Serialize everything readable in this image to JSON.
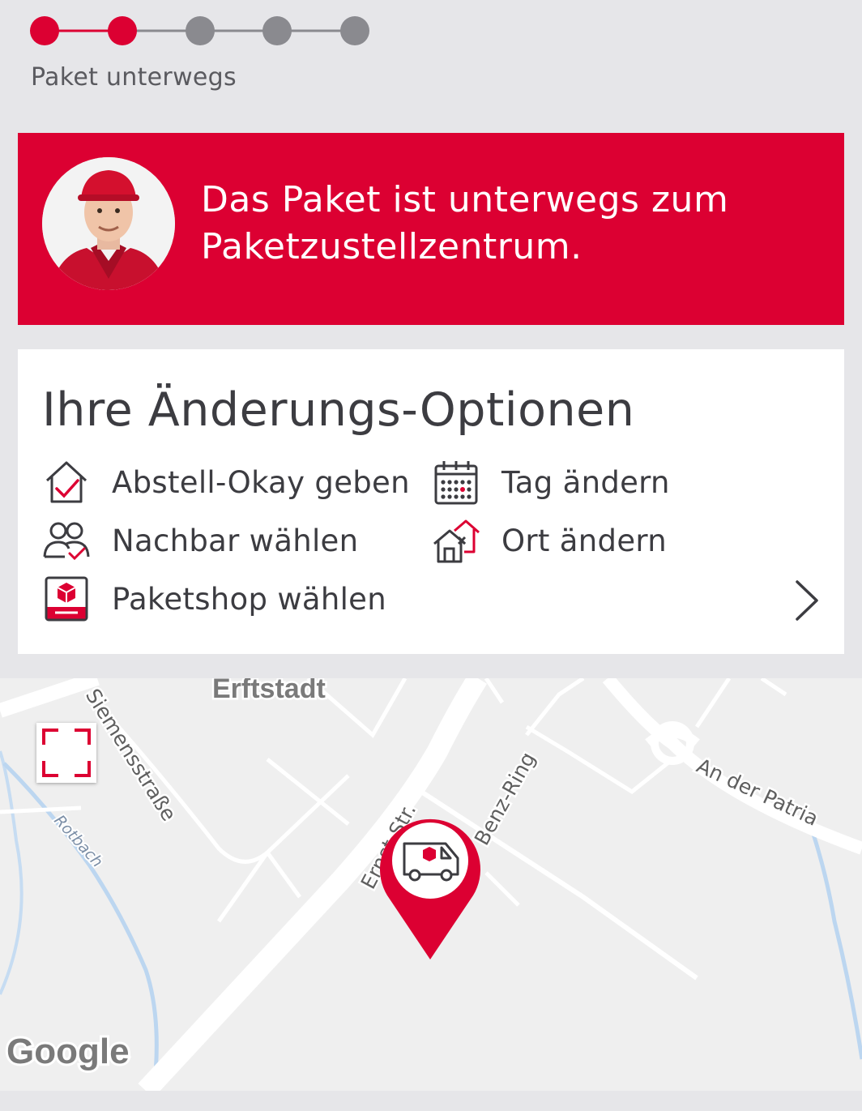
{
  "progress": {
    "total_steps": 5,
    "completed_steps": 2,
    "status_label": "Paket unterwegs",
    "active_color": "#dc0032",
    "inactive_color": "#8a8a8f"
  },
  "banner": {
    "message": "Das Paket ist unterwegs zum Paketzustellzentrum.",
    "background_color": "#dc0032"
  },
  "options": {
    "title": "Ihre Änderungs-Optionen",
    "items": [
      {
        "label": "Abstell-Okay geben",
        "icon": "house-check-icon"
      },
      {
        "label": "Tag ändern",
        "icon": "calendar-icon"
      },
      {
        "label": "Nachbar wählen",
        "icon": "neighbors-icon"
      },
      {
        "label": "Ort ändern",
        "icon": "house-change-icon"
      },
      {
        "label": "Paketshop wählen",
        "icon": "parcelshop-icon"
      }
    ],
    "more_icon": "chevron-right-icon"
  },
  "map": {
    "labels": {
      "city": "Erftstadt",
      "street_1": "Siemensstraße",
      "street_2": "Benz-Ring",
      "street_3": "An der Patria",
      "street_4": "Ernst-Str.",
      "water": "Rotbach"
    },
    "attribution": "Google",
    "marker_icon": "delivery-van-icon",
    "fullscreen_icon": "fullscreen-icon"
  }
}
